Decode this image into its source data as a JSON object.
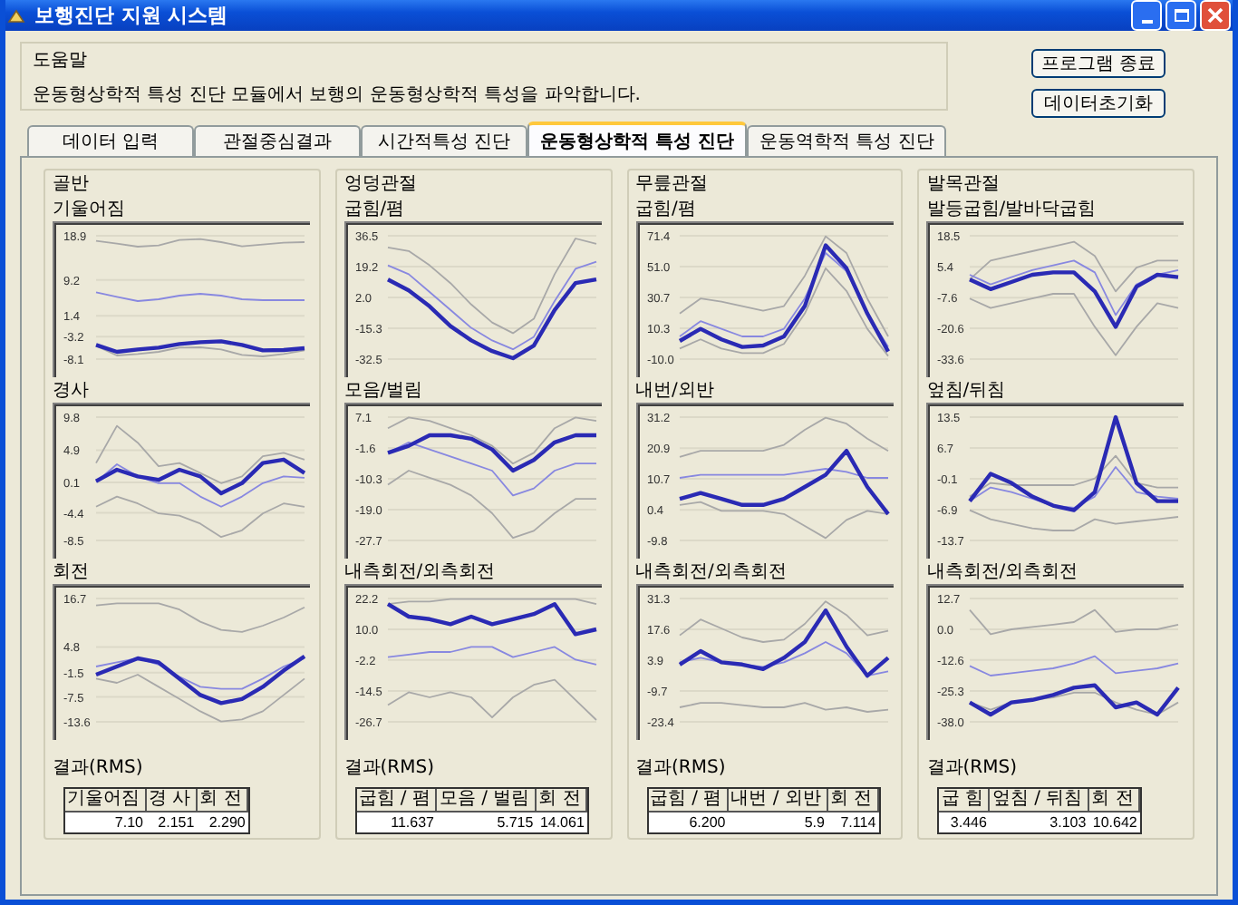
{
  "window": {
    "title": "보행진단 지원 시스템"
  },
  "help": {
    "title": "도움말",
    "text": "운동형상학적 특성 진단 모듈에서 보행의 운동형상학적 특성을 파악합니다."
  },
  "buttons": [
    "프로그램 종료",
    "데이터초기화"
  ],
  "tabs": [
    {
      "label": "데이터 입력",
      "selected": false
    },
    {
      "label": "관절중심결과",
      "selected": false
    },
    {
      "label": "시간적특성 진단",
      "selected": false
    },
    {
      "label": "운동형상학적 특성 진단",
      "selected": true
    },
    {
      "label": "운동역학적 특성 진단",
      "selected": false
    }
  ],
  "groups": [
    {
      "title": "골반",
      "charts": [
        {
          "title": "기울어짐",
          "chart_data": {
            "type": "line",
            "grid": true,
            "ylim": [
              -8.1,
              18.9
            ],
            "yticks": [
              18.9,
              9.2,
              1.4,
              -3.2,
              -8.1
            ],
            "series": [
              {
                "color": "#2a2ab4",
                "values": [
                  -5,
                  -6.5,
                  -6,
                  -5.6,
                  -4.8,
                  -4.4,
                  -4.2,
                  -5,
                  -6.2,
                  -6.1,
                  -5.7
                ]
              },
              {
                "color": "#8888e0",
                "values": [
                  6.5,
                  5.5,
                  4.6,
                  5,
                  5.8,
                  6.2,
                  5.8,
                  5,
                  4.8,
                  4.8,
                  4.8
                ]
              },
              {
                "color": "#a8a8a8",
                "values": [
                  17.8,
                  17.2,
                  16.5,
                  16.8,
                  18,
                  18.2,
                  17.5,
                  16.6,
                  17,
                  17.4,
                  17.5
                ]
              },
              {
                "color": "#a8a8a8",
                "values": [
                  -5.2,
                  -7.3,
                  -7,
                  -6.5,
                  -5.6,
                  -5.5,
                  -6,
                  -7.2,
                  -7.5,
                  -7,
                  -6.2
                ]
              }
            ]
          }
        },
        {
          "title": "경사",
          "chart_data": {
            "type": "line",
            "grid": true,
            "ylim": [
              -8.5,
              9.8
            ],
            "yticks": [
              9.8,
              4.9,
              0.1,
              -4.4,
              -8.5
            ],
            "series": [
              {
                "color": "#2a2ab4",
                "values": [
                  0.3,
                  2,
                  1,
                  0.5,
                  2,
                  1,
                  -1.5,
                  0,
                  3,
                  3.5,
                  1.5
                ]
              },
              {
                "color": "#8888e0",
                "values": [
                  0.2,
                  2.8,
                  1,
                  0,
                  0,
                  -2,
                  -3.5,
                  -2,
                  0,
                  1,
                  0.8
                ]
              },
              {
                "color": "#a8a8a8",
                "values": [
                  3,
                  8.5,
                  6,
                  2.5,
                  3,
                  1.5,
                  0,
                  1,
                  4,
                  4.5,
                  3.5
                ]
              },
              {
                "color": "#a8a8a8",
                "values": [
                  -3.5,
                  -2,
                  -3,
                  -4.5,
                  -4.8,
                  -6,
                  -8,
                  -7,
                  -4.5,
                  -3,
                  -3.5
                ]
              }
            ]
          }
        },
        {
          "title": "회전",
          "chart_data": {
            "type": "line",
            "grid": true,
            "ylim": [
              -13.6,
              16.7
            ],
            "yticks": [
              16.7,
              4.8,
              -1.5,
              -7.5,
              -13.6
            ],
            "series": [
              {
                "color": "#2a2ab4",
                "values": [
                  -2,
                  0,
                  2,
                  1,
                  -3,
                  -7,
                  -9,
                  -8,
                  -5,
                  -1,
                  2.5
                ]
              },
              {
                "color": "#8888e0",
                "values": [
                  0,
                  1,
                  2,
                  0.5,
                  -2.5,
                  -5,
                  -5.5,
                  -5.5,
                  -3,
                  0,
                  2
                ]
              },
              {
                "color": "#a8a8a8",
                "values": [
                  15,
                  15.5,
                  15.5,
                  15.5,
                  14,
                  11,
                  9,
                  8.5,
                  10,
                  12,
                  14.5
                ]
              },
              {
                "color": "#a8a8a8",
                "values": [
                  -3,
                  -4,
                  -2,
                  -5,
                  -8,
                  -11,
                  -13.5,
                  -13,
                  -11,
                  -7,
                  -3
                ]
              }
            ]
          }
        }
      ],
      "result_label": "결과(RMS)",
      "result_table": {
        "columns": [
          "기울어짐",
          "경 사",
          "회 전"
        ],
        "values": [
          "7.10",
          "2.151",
          "2.290"
        ]
      }
    },
    {
      "title": "엉덩관절",
      "charts": [
        {
          "title": "굽힘/폄",
          "chart_data": {
            "type": "line",
            "grid": true,
            "ylim": [
              -32.5,
              36.5
            ],
            "yticks": [
              36.5,
              19.2,
              {
                "value": 2,
                "label": "2.0"
              },
              -15.3,
              -32.5
            ],
            "series": [
              {
                "color": "#2a2ab4",
                "values": [
                  12,
                  6,
                  -3,
                  -14,
                  -22,
                  -28,
                  -32,
                  -25,
                  -5,
                  10,
                  12
                ]
              },
              {
                "color": "#8888e0",
                "values": [
                  20,
                  15,
                  5,
                  -5,
                  -15,
                  -22,
                  -27,
                  -20,
                  0,
                  18,
                  22
                ]
              },
              {
                "color": "#a8a8a8",
                "values": [
                  30,
                  28,
                  20,
                  10,
                  -2,
                  -12,
                  -18,
                  -10,
                  15,
                  35,
                  32
                ]
              }
            ]
          }
        },
        {
          "title": "모음/벌림",
          "chart_data": {
            "type": "line",
            "grid": true,
            "ylim": [
              -27.7,
              7.1
            ],
            "yticks": [
              7.1,
              -1.6,
              -10.3,
              {
                "value": -19,
                "label": "-19.0"
              },
              -27.7
            ],
            "series": [
              {
                "color": "#2a2ab4",
                "values": [
                  -3,
                  -1,
                  2,
                  2,
                  1,
                  -2,
                  -8,
                  -5,
                  0,
                  2,
                  2
                ]
              },
              {
                "color": "#8888e0",
                "values": [
                  -3,
                  0,
                  -2,
                  -4,
                  -6,
                  -8,
                  -15,
                  -13,
                  -8,
                  -6,
                  -6
                ]
              },
              {
                "color": "#a8a8a8",
                "values": [
                  4,
                  7,
                  6,
                  4,
                  2,
                  -1,
                  -6,
                  -3,
                  4,
                  7,
                  6
                ]
              },
              {
                "color": "#a8a8a8",
                "values": [
                  -12,
                  -8,
                  -10,
                  -12,
                  -15,
                  -20,
                  -27,
                  -25,
                  -20,
                  -16,
                  -16
                ]
              }
            ]
          }
        },
        {
          "title": "내측회전/외측회전",
          "chart_data": {
            "type": "line",
            "grid": true,
            "ylim": [
              -26.7,
              22.2
            ],
            "yticks": [
              22.2,
              {
                "value": 10,
                "label": "10.0"
              },
              -2.2,
              -14.5,
              -26.7
            ],
            "series": [
              {
                "color": "#2a2ab4",
                "values": [
                  20,
                  15,
                  14,
                  12,
                  15,
                  12,
                  14,
                  16,
                  20,
                  8,
                  10
                ]
              },
              {
                "color": "#8888e0",
                "values": [
                  -1,
                  0,
                  1,
                  1,
                  3,
                  3,
                  -1,
                  1,
                  3,
                  -2,
                  -4
                ]
              },
              {
                "color": "#a8a8a8",
                "values": [
                  20,
                  21,
                  21,
                  22,
                  22,
                  22,
                  22,
                  22,
                  22,
                  22,
                  20
                ]
              },
              {
                "color": "#a8a8a8",
                "values": [
                  -20,
                  -15,
                  -17,
                  -15,
                  -17,
                  -25,
                  -17,
                  -12,
                  -10,
                  -18,
                  -26
                ]
              }
            ]
          }
        }
      ],
      "result_label": "결과(RMS)",
      "result_table": {
        "columns": [
          "굽힘 / 폄",
          "모음 / 벌림",
          "회 전"
        ],
        "values": [
          "11.637",
          "5.715",
          "14.061"
        ]
      }
    },
    {
      "title": "무릎관절",
      "charts": [
        {
          "title": "굽힘/폄",
          "chart_data": {
            "type": "line",
            "grid": true,
            "ylim": [
              -10,
              71.4
            ],
            "yticks": [
              71.4,
              {
                "value": 51,
                "label": "51.0"
              },
              30.7,
              10.3,
              {
                "value": -10,
                "label": "-10.0"
              }
            ],
            "series": [
              {
                "color": "#2a2ab4",
                "values": [
                  2,
                  10,
                  3,
                  -2,
                  -1,
                  5,
                  25,
                  65,
                  50,
                  20,
                  -5
                ]
              },
              {
                "color": "#8888e0",
                "values": [
                  5,
                  15,
                  10,
                  5,
                  5,
                  10,
                  30,
                  60,
                  48,
                  20,
                  -2
                ]
              },
              {
                "color": "#a8a8a8",
                "values": [
                  20,
                  30,
                  28,
                  25,
                  22,
                  25,
                  45,
                  71,
                  60,
                  30,
                  5
                ]
              },
              {
                "color": "#a8a8a8",
                "values": [
                  -3,
                  3,
                  -3,
                  -6,
                  -6,
                  0,
                  20,
                  50,
                  35,
                  10,
                  -8
                ]
              }
            ]
          }
        },
        {
          "title": "내번/외반",
          "chart_data": {
            "type": "line",
            "grid": true,
            "ylim": [
              -9.8,
              31.2
            ],
            "yticks": [
              31.2,
              20.9,
              10.7,
              0.4,
              -9.8
            ],
            "series": [
              {
                "color": "#2a2ab4",
                "values": [
                  4,
                  6,
                  4,
                  2,
                  2,
                  4,
                  8,
                  12,
                  20,
                  8,
                  -1
                ]
              },
              {
                "color": "#8888e0",
                "values": [
                  11,
                  12,
                  12,
                  12,
                  12,
                  12,
                  13,
                  14,
                  13,
                  11,
                  11
                ]
              },
              {
                "color": "#a8a8a8",
                "values": [
                  18,
                  20,
                  20,
                  20,
                  20,
                  22,
                  27,
                  31,
                  29,
                  24,
                  20
                ]
              },
              {
                "color": "#a8a8a8",
                "values": [
                  2,
                  3,
                  0,
                  0,
                  0,
                  -1,
                  -5,
                  -9,
                  -3,
                  0,
                  -1
                ]
              }
            ]
          }
        },
        {
          "title": "내측회전/외측회전",
          "chart_data": {
            "type": "line",
            "grid": true,
            "ylim": [
              -23.4,
              31.3
            ],
            "yticks": [
              31.3,
              17.6,
              3.9,
              -9.7,
              -23.4
            ],
            "series": [
              {
                "color": "#2a2ab4",
                "values": [
                  2,
                  8,
                  3,
                  2,
                  0,
                  5,
                  12,
                  26,
                  10,
                  -3,
                  5
                ]
              },
              {
                "color": "#8888e0",
                "values": [
                  3,
                  5,
                  3,
                  2,
                  1,
                  3,
                  7,
                  12,
                  7,
                  -3,
                  -1
                ]
              },
              {
                "color": "#a8a8a8",
                "values": [
                  15,
                  22,
                  18,
                  14,
                  12,
                  13,
                  20,
                  30,
                  24,
                  15,
                  17
                ]
              },
              {
                "color": "#a8a8a8",
                "values": [
                  -17,
                  -15,
                  -15,
                  -16,
                  -17,
                  -17,
                  -15,
                  -18,
                  -17,
                  -19,
                  -18
                ]
              }
            ]
          }
        }
      ],
      "result_label": "결과(RMS)",
      "result_table": {
        "columns": [
          "굽힘 / 폄",
          "내번 / 외반",
          "회 전"
        ],
        "values": [
          "6.200",
          "5.9",
          "7.114"
        ]
      }
    },
    {
      "title": "발목관절",
      "charts": [
        {
          "title": "발등굽힘/발바닥굽힘",
          "chart_data": {
            "type": "line",
            "grid": true,
            "ylim": [
              -33.6,
              18.5
            ],
            "yticks": [
              18.5,
              5.4,
              -7.6,
              -20.6,
              -33.6
            ],
            "series": [
              {
                "color": "#2a2ab4",
                "values": [
                  0,
                  -4,
                  -1,
                  2,
                  3,
                  3,
                  -5,
                  -20,
                  -3,
                  2,
                  1
                ]
              },
              {
                "color": "#8888e0",
                "values": [
                  2,
                  -2,
                  1,
                  4,
                  6,
                  8,
                  3,
                  -15,
                  -2,
                  2,
                  4
                ]
              },
              {
                "color": "#a8a8a8",
                "values": [
                  0,
                  8,
                  10,
                  12,
                  14,
                  16,
                  10,
                  -5,
                  5,
                  8,
                  8
                ]
              },
              {
                "color": "#a8a8a8",
                "values": [
                  -8,
                  -12,
                  -10,
                  -8,
                  -6,
                  -6,
                  -20,
                  -32,
                  -20,
                  -10,
                  -12
                ]
              }
            ]
          }
        },
        {
          "title": "엎침/뒤침",
          "chart_data": {
            "type": "line",
            "grid": true,
            "ylim": [
              -13.7,
              13.5
            ],
            "yticks": [
              13.5,
              6.7,
              -0.1,
              -6.9,
              -13.7
            ],
            "series": [
              {
                "color": "#2a2ab4",
                "values": [
                  -5,
                  1,
                  -1,
                  -4,
                  -6,
                  -7,
                  -3,
                  13.5,
                  -1,
                  -5,
                  -5
                ]
              },
              {
                "color": "#8888e0",
                "values": [
                  -5,
                  -2,
                  -3,
                  -4.5,
                  -6,
                  -6.5,
                  -4,
                  2.5,
                  -3,
                  -4,
                  -4.5
                ]
              },
              {
                "color": "#a8a8a8",
                "values": [
                  -4,
                  -1,
                  -1.5,
                  -1.5,
                  -1.5,
                  -1.5,
                  0,
                  5,
                  -1,
                  -2,
                  -2
                ]
              },
              {
                "color": "#a8a8a8",
                "values": [
                  -7,
                  -9,
                  -10,
                  -11,
                  -11.5,
                  -11.5,
                  -9,
                  -10,
                  -9.5,
                  -9,
                  -8.5
                ]
              }
            ]
          }
        },
        {
          "title": "내측회전/외측회전",
          "chart_data": {
            "type": "line",
            "grid": true,
            "ylim": [
              -38,
              12.7
            ],
            "yticks": [
              12.7,
              {
                "value": 0,
                "label": "0.0"
              },
              -12.6,
              -25.3,
              {
                "value": -38,
                "label": "-38.0"
              }
            ],
            "series": [
              {
                "color": "#2a2ab4",
                "values": [
                  -30,
                  -35,
                  -30,
                  -29,
                  -27,
                  -24,
                  -23,
                  -32,
                  -30,
                  -35,
                  -24
                ]
              },
              {
                "color": "#8888e0",
                "values": [
                  -15,
                  -19,
                  -18,
                  -17,
                  -16,
                  -14,
                  -11,
                  -18,
                  -17,
                  -16,
                  -14
                ]
              },
              {
                "color": "#a8a8a8",
                "values": [
                  8,
                  -2,
                  0,
                  1,
                  2,
                  3,
                  8,
                  -1,
                  0,
                  0,
                  2
                ]
              },
              {
                "color": "#a8a8a8",
                "values": [
                  -30,
                  -33,
                  -30,
                  -29,
                  -28,
                  -26,
                  -26,
                  -30,
                  -33,
                  -35,
                  -30
                ]
              }
            ]
          }
        }
      ],
      "result_label": "결과(RMS)",
      "result_table": {
        "columns": [
          "굽 힘",
          "엎침 / 뒤침",
          "회 전"
        ],
        "values": [
          "3.446",
          "3.103",
          "10.642"
        ]
      }
    }
  ]
}
